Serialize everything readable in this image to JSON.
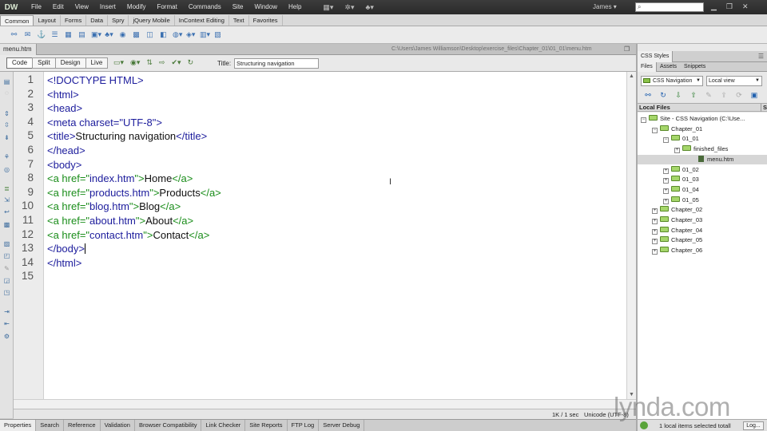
{
  "menubar": {
    "logo": "DW",
    "items": [
      "File",
      "Edit",
      "View",
      "Insert",
      "Modify",
      "Format",
      "Commands",
      "Site",
      "Window",
      "Help"
    ],
    "user": "James ▾"
  },
  "insert_tabs": [
    "Common",
    "Layout",
    "Forms",
    "Data",
    "Spry",
    "jQuery Mobile",
    "InContext Editing",
    "Text",
    "Favorites"
  ],
  "document": {
    "tab_name": "menu.htm",
    "path": "C:\\Users\\James Williamson\\Desktop\\exercise_files\\Chapter_01\\01_01\\menu.htm",
    "view_buttons": [
      "Code",
      "Split",
      "Design",
      "Live"
    ],
    "title_label": "Title:",
    "title_value": "Structuring navigation"
  },
  "code": {
    "lines": [
      {
        "num": "1",
        "parts": [
          [
            "tag",
            "<!DOCTYPE HTML>"
          ]
        ]
      },
      {
        "num": "2",
        "parts": [
          [
            "tag",
            "<html>"
          ]
        ]
      },
      {
        "num": "3",
        "parts": [
          [
            "tag",
            "<head>"
          ]
        ]
      },
      {
        "num": "4",
        "parts": [
          [
            "tag",
            "<meta charset=\"UTF-8\">"
          ]
        ]
      },
      {
        "num": "5",
        "parts": [
          [
            "tag",
            "<title>"
          ],
          [
            "text",
            "Structuring navigation"
          ],
          [
            "tag",
            "</title>"
          ]
        ]
      },
      {
        "num": "6",
        "parts": [
          [
            "tag",
            "</head>"
          ]
        ]
      },
      {
        "num": "7",
        "parts": [
          [
            "tag",
            "<body>"
          ]
        ]
      },
      {
        "num": "8",
        "parts": [
          [
            "link",
            "<a href=\""
          ],
          [
            "val",
            "index.htm"
          ],
          [
            "link",
            "\">"
          ],
          [
            "text",
            "Home"
          ],
          [
            "link",
            "</a>"
          ]
        ]
      },
      {
        "num": "9",
        "parts": [
          [
            "link",
            "<a href=\""
          ],
          [
            "val",
            "products.htm"
          ],
          [
            "link",
            "\">"
          ],
          [
            "text",
            "Products"
          ],
          [
            "link",
            "</a>"
          ]
        ]
      },
      {
        "num": "10",
        "parts": [
          [
            "link",
            "<a href=\""
          ],
          [
            "val",
            "blog.htm"
          ],
          [
            "link",
            "\">"
          ],
          [
            "text",
            "Blog"
          ],
          [
            "link",
            "</a>"
          ]
        ]
      },
      {
        "num": "11",
        "parts": [
          [
            "link",
            "<a href=\""
          ],
          [
            "val",
            "about.htm"
          ],
          [
            "link",
            "\">"
          ],
          [
            "text",
            "About"
          ],
          [
            "link",
            "</a>"
          ]
        ]
      },
      {
        "num": "12",
        "parts": [
          [
            "link",
            "<a href=\""
          ],
          [
            "val",
            "contact.htm"
          ],
          [
            "link",
            "\">"
          ],
          [
            "text",
            "Contact"
          ],
          [
            "link",
            "</a>"
          ]
        ]
      },
      {
        "num": "13",
        "parts": [
          [
            "tag",
            "</body>"
          ]
        ],
        "cursor": true
      },
      {
        "num": "14",
        "parts": [
          [
            "tag",
            "</html>"
          ]
        ]
      },
      {
        "num": "15",
        "parts": []
      }
    ]
  },
  "statusbar": {
    "size": "1K / 1 sec",
    "encoding": "Unicode (UTF-8)"
  },
  "bottom_tabs": [
    "Properties",
    "Search",
    "Reference",
    "Validation",
    "Browser Compatibility",
    "Link Checker",
    "Site Reports",
    "FTP Log",
    "Server Debug"
  ],
  "right_panel": {
    "top_tab": "CSS Styles",
    "files_tabs": [
      "Files",
      "Assets",
      "Snippets"
    ],
    "site_select": "CSS Navigation",
    "view_select": "Local view",
    "header_local": "Local Files",
    "header_size": "Si",
    "tree": [
      {
        "label": "Site - CSS Navigation (C:\\Use...",
        "type": "site",
        "exp": "−"
      },
      {
        "label": "Chapter_01",
        "type": "folder",
        "exp": "−"
      },
      {
        "label": "01_01",
        "type": "folder",
        "exp": "−"
      },
      {
        "label": "finished_files",
        "type": "folder",
        "exp": "+"
      },
      {
        "label": "menu.htm",
        "type": "file",
        "exp": ""
      },
      {
        "label": "01_02",
        "type": "folder",
        "exp": "+"
      },
      {
        "label": "01_03",
        "type": "folder",
        "exp": "+"
      },
      {
        "label": "01_04",
        "type": "folder",
        "exp": "+"
      },
      {
        "label": "01_05",
        "type": "folder",
        "exp": "+"
      },
      {
        "label": "Chapter_02",
        "type": "folder",
        "exp": "+"
      },
      {
        "label": "Chapter_03",
        "type": "folder",
        "exp": "+"
      },
      {
        "label": "Chapter_04",
        "type": "folder",
        "exp": "+"
      },
      {
        "label": "Chapter_05",
        "type": "folder",
        "exp": "+"
      },
      {
        "label": "Chapter_06",
        "type": "folder",
        "exp": "+"
      }
    ],
    "status_text": "1 local items selected totall",
    "log_button": "Log..."
  },
  "watermark": "lynda.com",
  "colors": {
    "tag": "#1c1c9c",
    "link": "#1a8d1a",
    "text": "#111111"
  }
}
